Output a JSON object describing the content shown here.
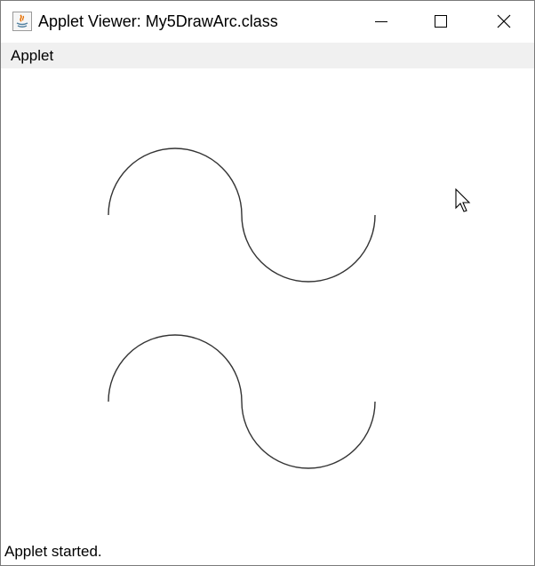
{
  "window": {
    "title": "Applet Viewer: My5DrawArc.class",
    "icon": "java-icon",
    "controls": [
      "minimize-icon",
      "maximize-icon",
      "close-icon"
    ]
  },
  "menubar": {
    "items": [
      {
        "label": "Applet"
      }
    ]
  },
  "canvas": {
    "shapes": [
      {
        "type": "s-curve-arcs",
        "description_free": true
      },
      {
        "type": "s-curve-arcs",
        "description_free": true
      }
    ]
  },
  "status": {
    "text": "Applet started."
  },
  "colors": {
    "menubar_bg": "#f0f0f0",
    "canvas_bg": "#ffffff",
    "stroke": "#333333"
  }
}
